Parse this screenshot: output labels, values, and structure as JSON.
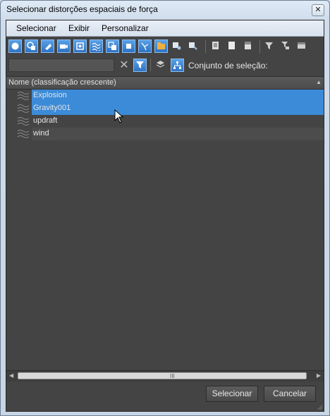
{
  "window": {
    "title": "Selecionar distorções espaciais de força",
    "close_glyph": "✕"
  },
  "menubar": {
    "items": [
      "Selecionar",
      "Exibir",
      "Personalizar"
    ]
  },
  "toolbar": {
    "icons": [
      "geometry-filter-icon",
      "shapes-filter-icon",
      "lights-filter-icon",
      "cameras-filter-icon",
      "helpers-filter-icon",
      "space-warps-filter-icon",
      "groups-filter-icon",
      "xrefs-filter-icon",
      "bones-filter-icon",
      "containers-filter-icon",
      "frozen-filter-icon",
      "hidden-filter-icon",
      "select-all-icon",
      "select-none-icon",
      "select-invert-icon",
      "filter-icon",
      "filter-options-icon",
      "display-options-icon"
    ]
  },
  "filter": {
    "value": "",
    "clear_glyph": "✕",
    "selection_set_label": "Conjunto de seleção:"
  },
  "list": {
    "header": "Nome (classificação crescente)",
    "sort_glyph": "▲",
    "items": [
      {
        "name": "Explosion",
        "selected": true
      },
      {
        "name": "Gravity001",
        "selected": true
      },
      {
        "name": "updraft",
        "selected": false
      },
      {
        "name": "wind",
        "selected": false
      }
    ]
  },
  "scrollbar": {
    "left_glyph": "◀",
    "right_glyph": "▶",
    "grip_glyph": "III"
  },
  "buttons": {
    "select": "Selecionar",
    "cancel": "Cancelar"
  },
  "colors": {
    "panel_bg": "#444444",
    "selection": "#3c8bd8",
    "toolbar_active": "#2e73c4"
  }
}
